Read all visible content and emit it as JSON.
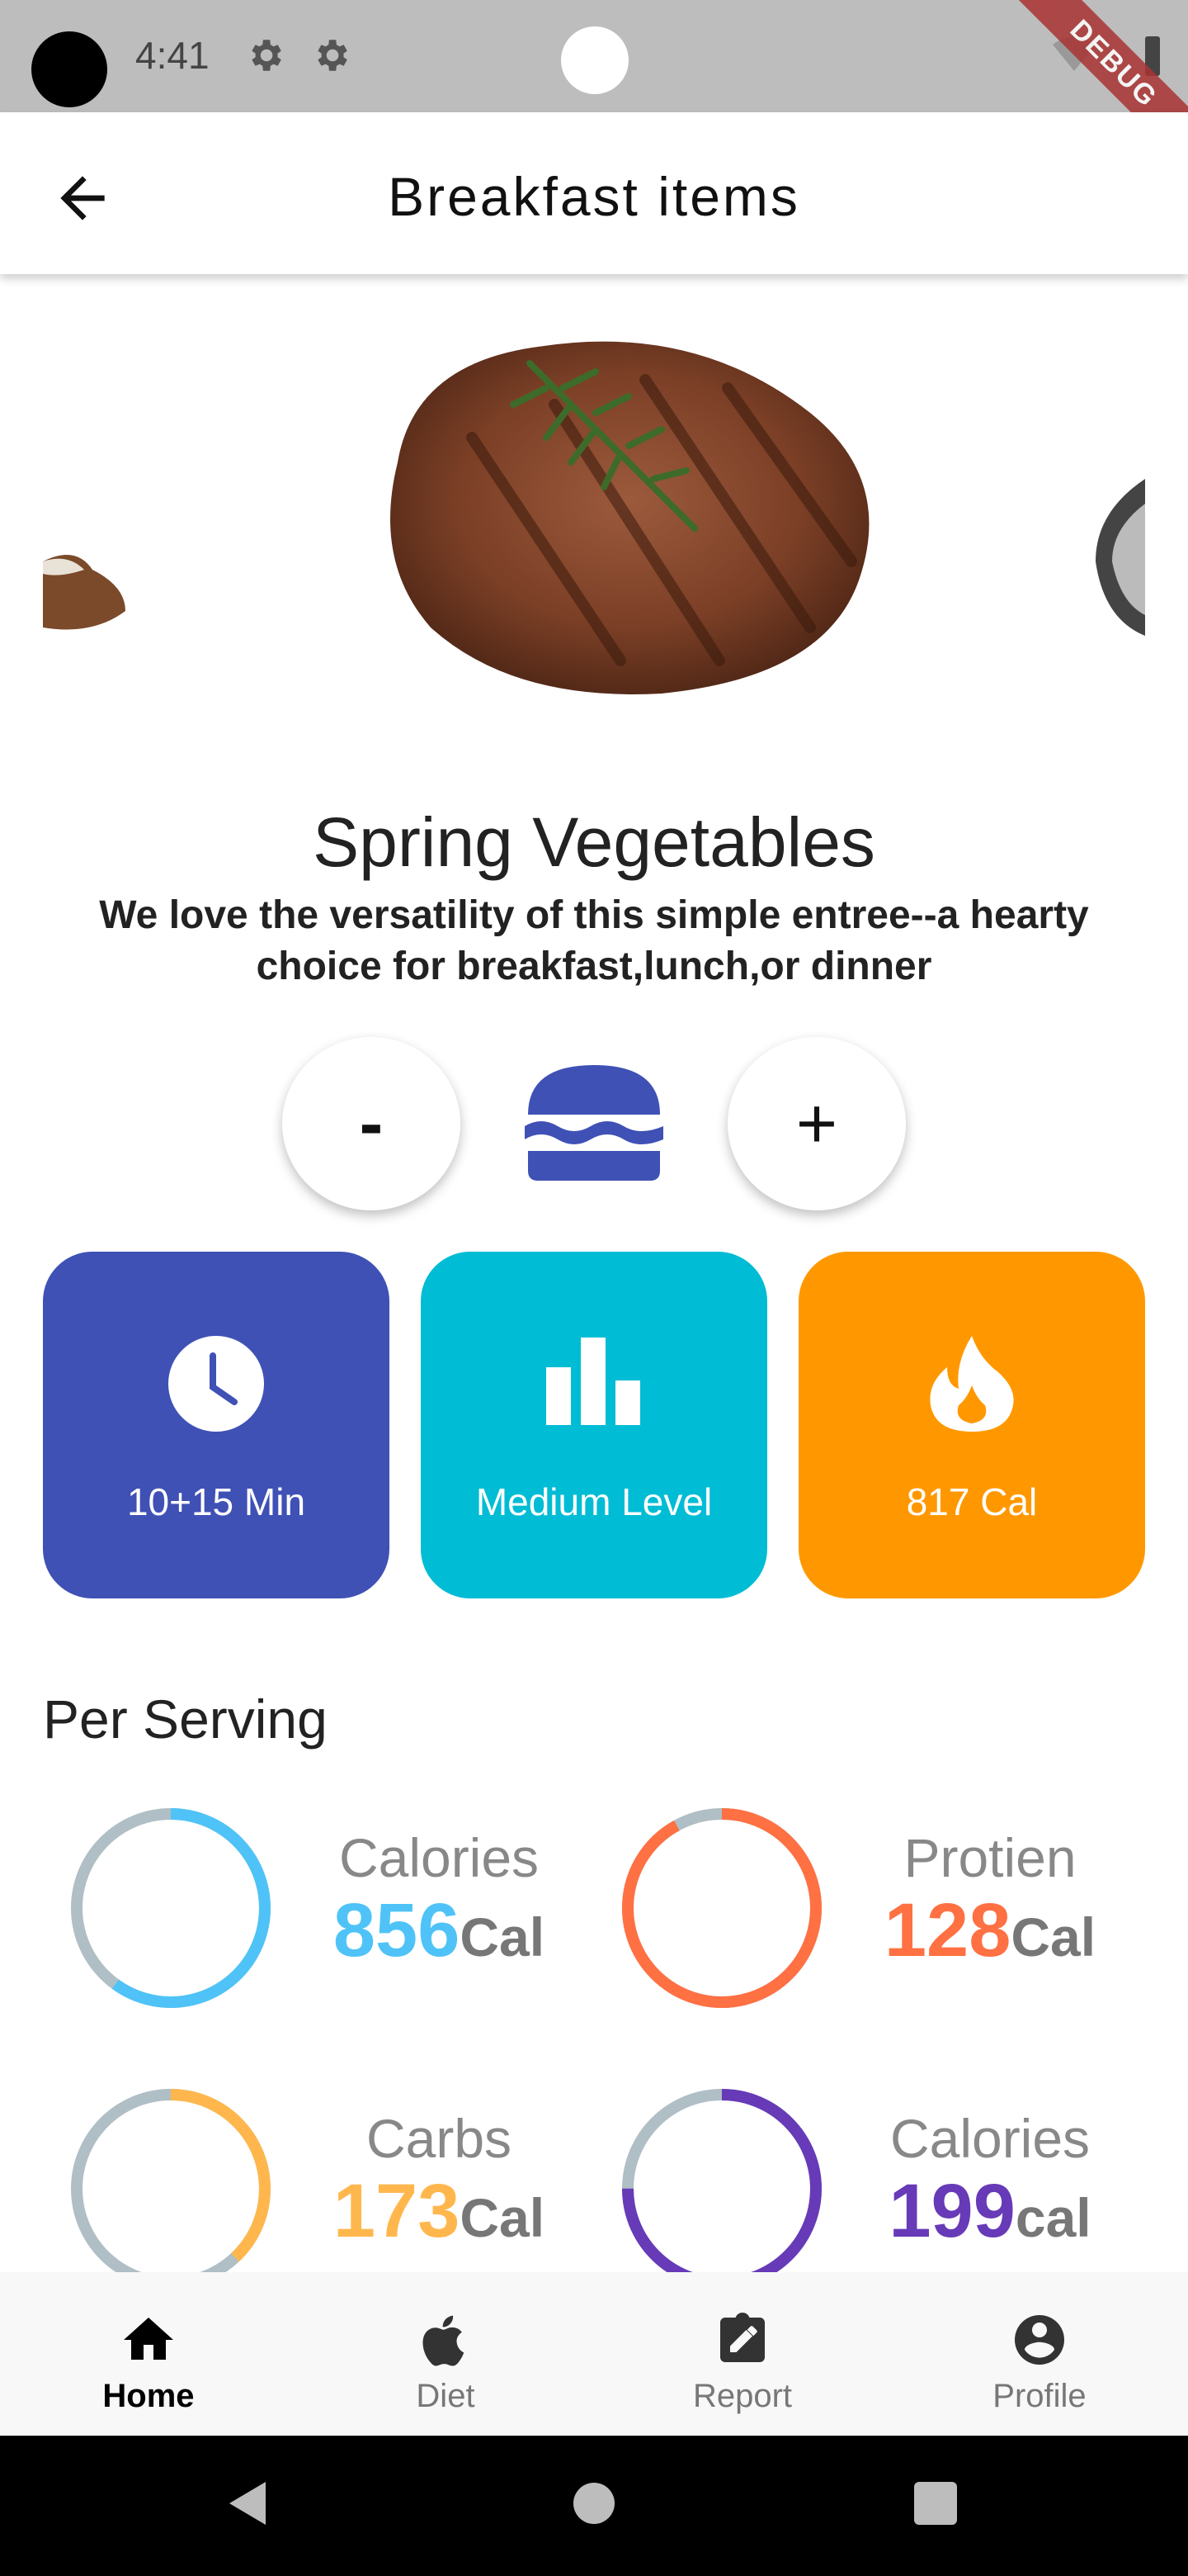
{
  "status_bar": {
    "time": "4:41",
    "debug_label": "DEBUG"
  },
  "app_bar": {
    "title": "Breakfast items"
  },
  "dish": {
    "title": "Spring Vegetables",
    "description": "We love the versatility of this simple entree--a hearty choice for breakfast,lunch,or dinner"
  },
  "quantity": {
    "minus_label": "-",
    "plus_label": "+"
  },
  "info_cards": {
    "time": "10+15 Min",
    "level": "Medium Level",
    "calories": "817 Cal"
  },
  "per_serving": {
    "title": "Per Serving",
    "items": [
      {
        "label": "Calories",
        "value": "856",
        "unit": "Cal",
        "color": "#4fc3f7",
        "progress": 0.6
      },
      {
        "label": "Protien",
        "value": "128",
        "unit": "Cal",
        "color": "#ff7043",
        "progress": 0.92
      },
      {
        "label": "Carbs",
        "value": "173",
        "unit": "Cal",
        "color": "#ffb74d",
        "progress": 0.38
      },
      {
        "label": "Calories",
        "value": "199",
        "unit": "cal",
        "color": "#673ab7",
        "progress": 0.75
      }
    ]
  },
  "bottom_nav": {
    "items": [
      {
        "label": "Home",
        "icon": "home-icon",
        "active": true
      },
      {
        "label": "Diet",
        "icon": "apple-icon",
        "active": false
      },
      {
        "label": "Report",
        "icon": "report-icon",
        "active": false
      },
      {
        "label": "Profile",
        "icon": "profile-icon",
        "active": false
      }
    ]
  }
}
